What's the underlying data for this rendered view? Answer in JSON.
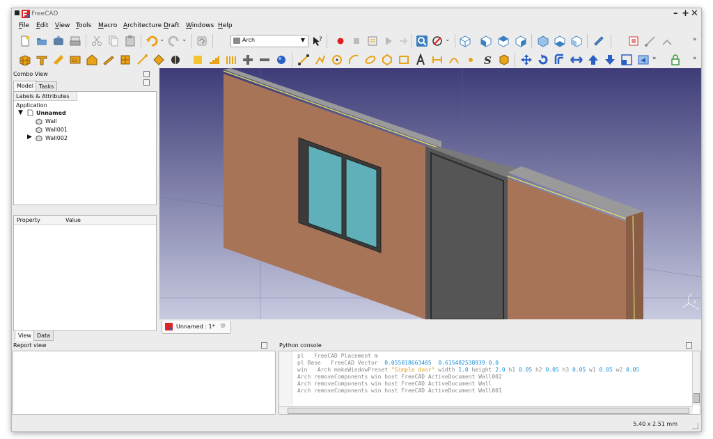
{
  "window": {
    "title": "FreeCAD",
    "controls": [
      "–",
      "+",
      "✕"
    ]
  },
  "menu": [
    {
      "label": "File",
      "accel": "F",
      "rest": "ile"
    },
    {
      "label": "Edit",
      "accel": "E",
      "rest": "dit"
    },
    {
      "label": "View",
      "accel": "V",
      "rest": "iew"
    },
    {
      "label": "Tools",
      "accel": "T",
      "rest": "ools"
    },
    {
      "label": "Macro",
      "accel": "M",
      "rest": "acro"
    },
    {
      "label": "Architecture",
      "accel": "A",
      "rest": "rchitecture"
    },
    {
      "label": "Draft",
      "accel": "D",
      "rest": "raft"
    },
    {
      "label": "Windows",
      "accel": "W",
      "rest": "indows"
    },
    {
      "label": "Help",
      "accel": "H",
      "rest": "elp"
    }
  ],
  "toolbar": {
    "workbench_selector": "Arch",
    "overflow": "»"
  },
  "combo_view": {
    "title": "Combo View",
    "tabs": [
      "Model",
      "Tasks"
    ],
    "active_tab": "Model",
    "labels_header": "Labels & Attributes",
    "application_label": "Application",
    "tree": {
      "document": "Unnamed",
      "items": [
        "Wall",
        "Wall001",
        "Wall002"
      ]
    },
    "property_columns": [
      "Property",
      "Value"
    ],
    "bottom_tabs": [
      "View",
      "Data"
    ]
  },
  "document_tab": {
    "label": "Unnamed : 1*"
  },
  "report_view": {
    "title": "Report view"
  },
  "python_console": {
    "title": "Python console",
    "lines": [
      {
        "parts": [
          {
            "t": "pl   FreeCAD Placement m",
            "k": ""
          }
        ]
      },
      {
        "parts": [
          {
            "t": "pl Base   FreeCAD Vector  ",
            "k": ""
          },
          {
            "t": "0.055018663405",
            "k": "n"
          },
          {
            "t": "  ",
            "k": ""
          },
          {
            "t": "0.615482538939",
            "k": "n"
          },
          {
            "t": " ",
            "k": ""
          },
          {
            "t": "0.0",
            "k": "n"
          }
        ]
      },
      {
        "parts": [
          {
            "t": "win   Arch makeWindowPreset ",
            "k": ""
          },
          {
            "t": "\"Simple door\"",
            "k": "s"
          },
          {
            "t": " width ",
            "k": ""
          },
          {
            "t": "1.0",
            "k": "n"
          },
          {
            "t": " height ",
            "k": ""
          },
          {
            "t": "2.0",
            "k": "n"
          },
          {
            "t": " h1 ",
            "k": ""
          },
          {
            "t": "0.05",
            "k": "n"
          },
          {
            "t": " h2 ",
            "k": ""
          },
          {
            "t": "0.05",
            "k": "n"
          },
          {
            "t": " h3 ",
            "k": ""
          },
          {
            "t": "0.05",
            "k": "n"
          },
          {
            "t": " w1 ",
            "k": ""
          },
          {
            "t": "0.05",
            "k": "n"
          },
          {
            "t": " w2 ",
            "k": ""
          },
          {
            "t": "0.05",
            "k": "n"
          }
        ]
      },
      {
        "parts": [
          {
            "t": "Arch removeComponents win host FreeCAD ActiveDocument Wall002",
            "k": ""
          }
        ]
      },
      {
        "parts": [
          {
            "t": "Arch removeComponents win host FreeCAD ActiveDocument Wall",
            "k": ""
          }
        ]
      },
      {
        "parts": [
          {
            "t": "Arch removeComponents win host FreeCAD ActiveDocument Wall001",
            "k": ""
          }
        ]
      }
    ]
  },
  "status": {
    "dimensions": "5.40 x 2.51 mm"
  },
  "axis_labels": [
    "z",
    "y",
    "x"
  ],
  "colors": {
    "wall_face": "#a87458",
    "wall_top": "#9a9a9a",
    "glass": "#5fb0b8",
    "door": "#555555",
    "yellow_edge": "#d8d860",
    "bg_top": "#3e3c78",
    "bg_bottom": "#c7cadf"
  }
}
